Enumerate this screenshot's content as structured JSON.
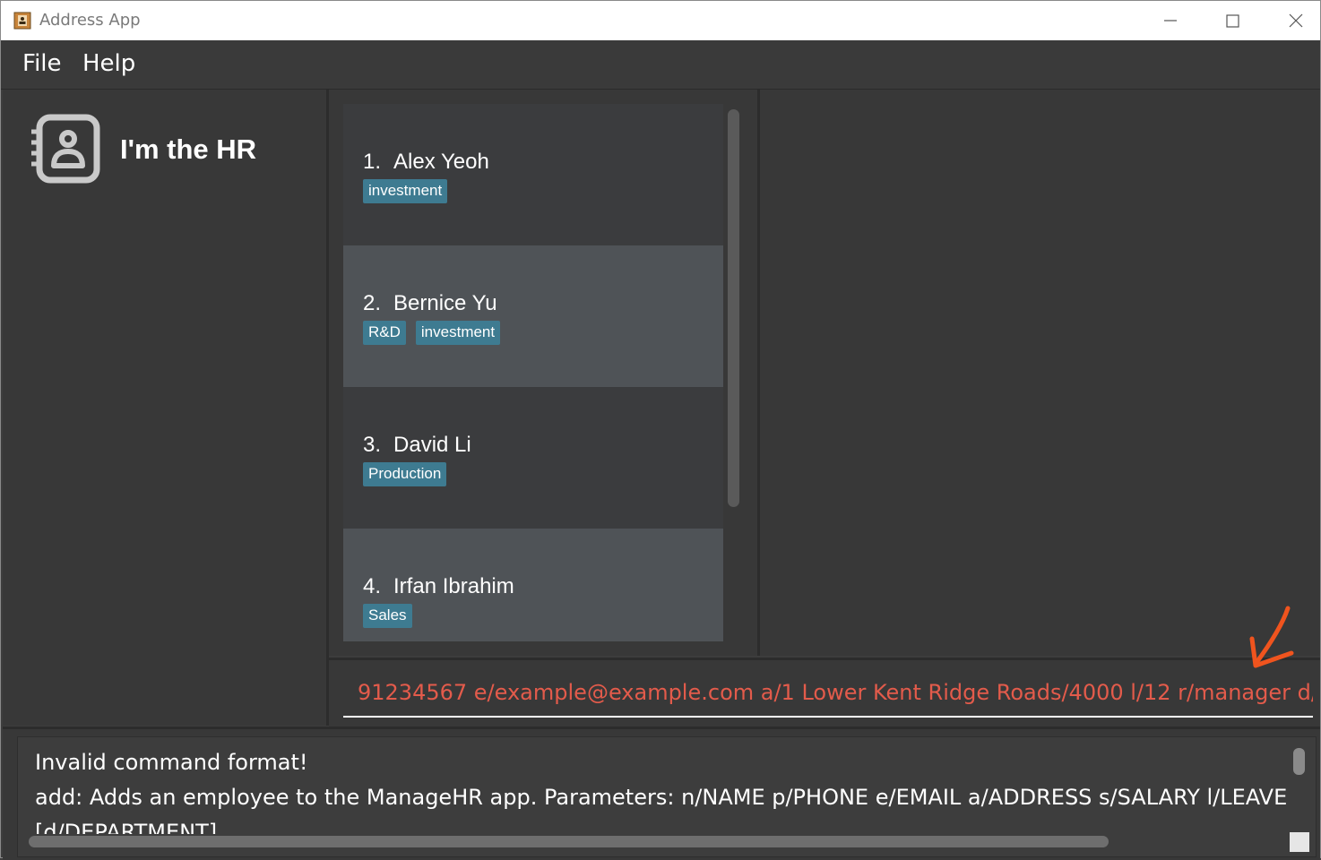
{
  "window": {
    "title": "Address App",
    "minimize_icon": "minimize-icon",
    "maximize_icon": "maximize-icon",
    "close_icon": "close-icon"
  },
  "menu": {
    "items": [
      {
        "label": "File"
      },
      {
        "label": "Help"
      }
    ]
  },
  "sidebar": {
    "icon": "address-book-icon",
    "title": "I'm the HR"
  },
  "persons": [
    {
      "index": "1.",
      "name": "Alex Yeoh",
      "tags": [
        "investment"
      ]
    },
    {
      "index": "2.",
      "name": "Bernice Yu",
      "tags": [
        "R&D",
        "investment"
      ]
    },
    {
      "index": "3.",
      "name": "David Li",
      "tags": [
        "Production"
      ]
    },
    {
      "index": "4.",
      "name": "Irfan Ibrahim",
      "tags": [
        "Sales"
      ]
    }
  ],
  "command": {
    "value": "91234567 e/example@example.com a/1 Lower Kent Ridge Roads/4000 l/12 r/manager d/SoC HR",
    "text_color": "#e35b4b"
  },
  "result": {
    "lines": [
      "Invalid command format!",
      "add: Adds an employee to the ManageHR app. Parameters: n/NAME p/PHONE e/EMAIL a/ADDRESS s/SALARY l/LEAVE r/ROLE [",
      "[d/DEPARTMENT]"
    ]
  },
  "colors": {
    "tag": "#3e7b91",
    "card_dark": "#3b3c3e",
    "card_light": "#4f5357",
    "annotation": "#f0541e"
  }
}
